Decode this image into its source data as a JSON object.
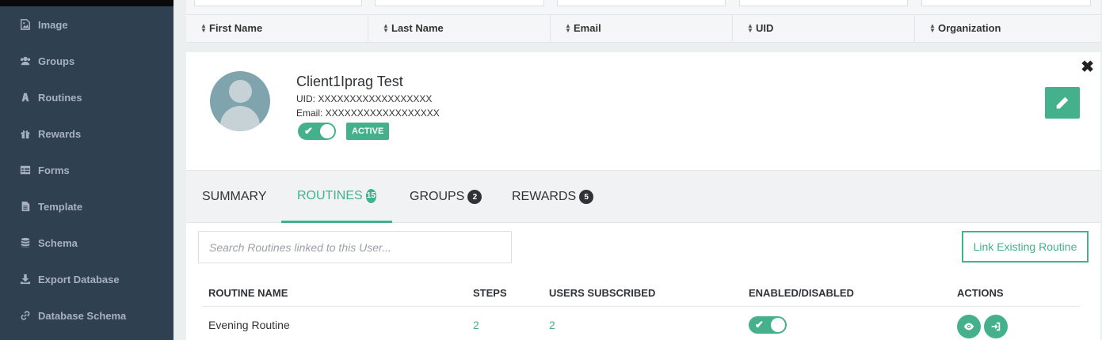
{
  "sidebar": {
    "items": [
      {
        "label": "Image",
        "icon": "image-icon"
      },
      {
        "label": "Groups",
        "icon": "users-icon"
      },
      {
        "label": "Routines",
        "icon": "routines-icon"
      },
      {
        "label": "Rewards",
        "icon": "gift-icon"
      },
      {
        "label": "Forms",
        "icon": "table-icon"
      },
      {
        "label": "Template",
        "icon": "file-icon"
      },
      {
        "label": "Schema",
        "icon": "database-icon"
      },
      {
        "label": "Export Database",
        "icon": "download-icon"
      },
      {
        "label": "Database Schema",
        "icon": "link-icon"
      }
    ]
  },
  "users_table": {
    "columns": [
      "First Name",
      "Last Name",
      "Email",
      "UID",
      "Organization"
    ]
  },
  "user": {
    "name": "Client1Iprag Test",
    "uid": "UID: XXXXXXXXXXXXXXXXXX",
    "email": "Email: XXXXXXXXXXXXXXXXXX",
    "status": "ACTIVE",
    "enabled": true
  },
  "tabs": [
    {
      "label": "SUMMARY",
      "count": null,
      "active": false
    },
    {
      "label": "ROUTINES",
      "count": "15",
      "active": true
    },
    {
      "label": "GROUPS",
      "count": "2",
      "active": false
    },
    {
      "label": "REWARDS",
      "count": "5",
      "active": false
    }
  ],
  "routines": {
    "search_placeholder": "Search Routines linked to this User...",
    "link_button": "Link Existing Routine",
    "columns": [
      "ROUTINE NAME",
      "STEPS",
      "USERS SUBSCRIBED",
      "ENABLED/DISABLED",
      "ACTIONS"
    ],
    "rows": [
      {
        "name": "Evening Routine",
        "steps": "2",
        "users_subscribed": "2",
        "enabled": true
      }
    ]
  },
  "colors": {
    "accent": "#45b08c",
    "sidebar": "#2f4050",
    "sidebar_text": "#a7b1c2"
  }
}
